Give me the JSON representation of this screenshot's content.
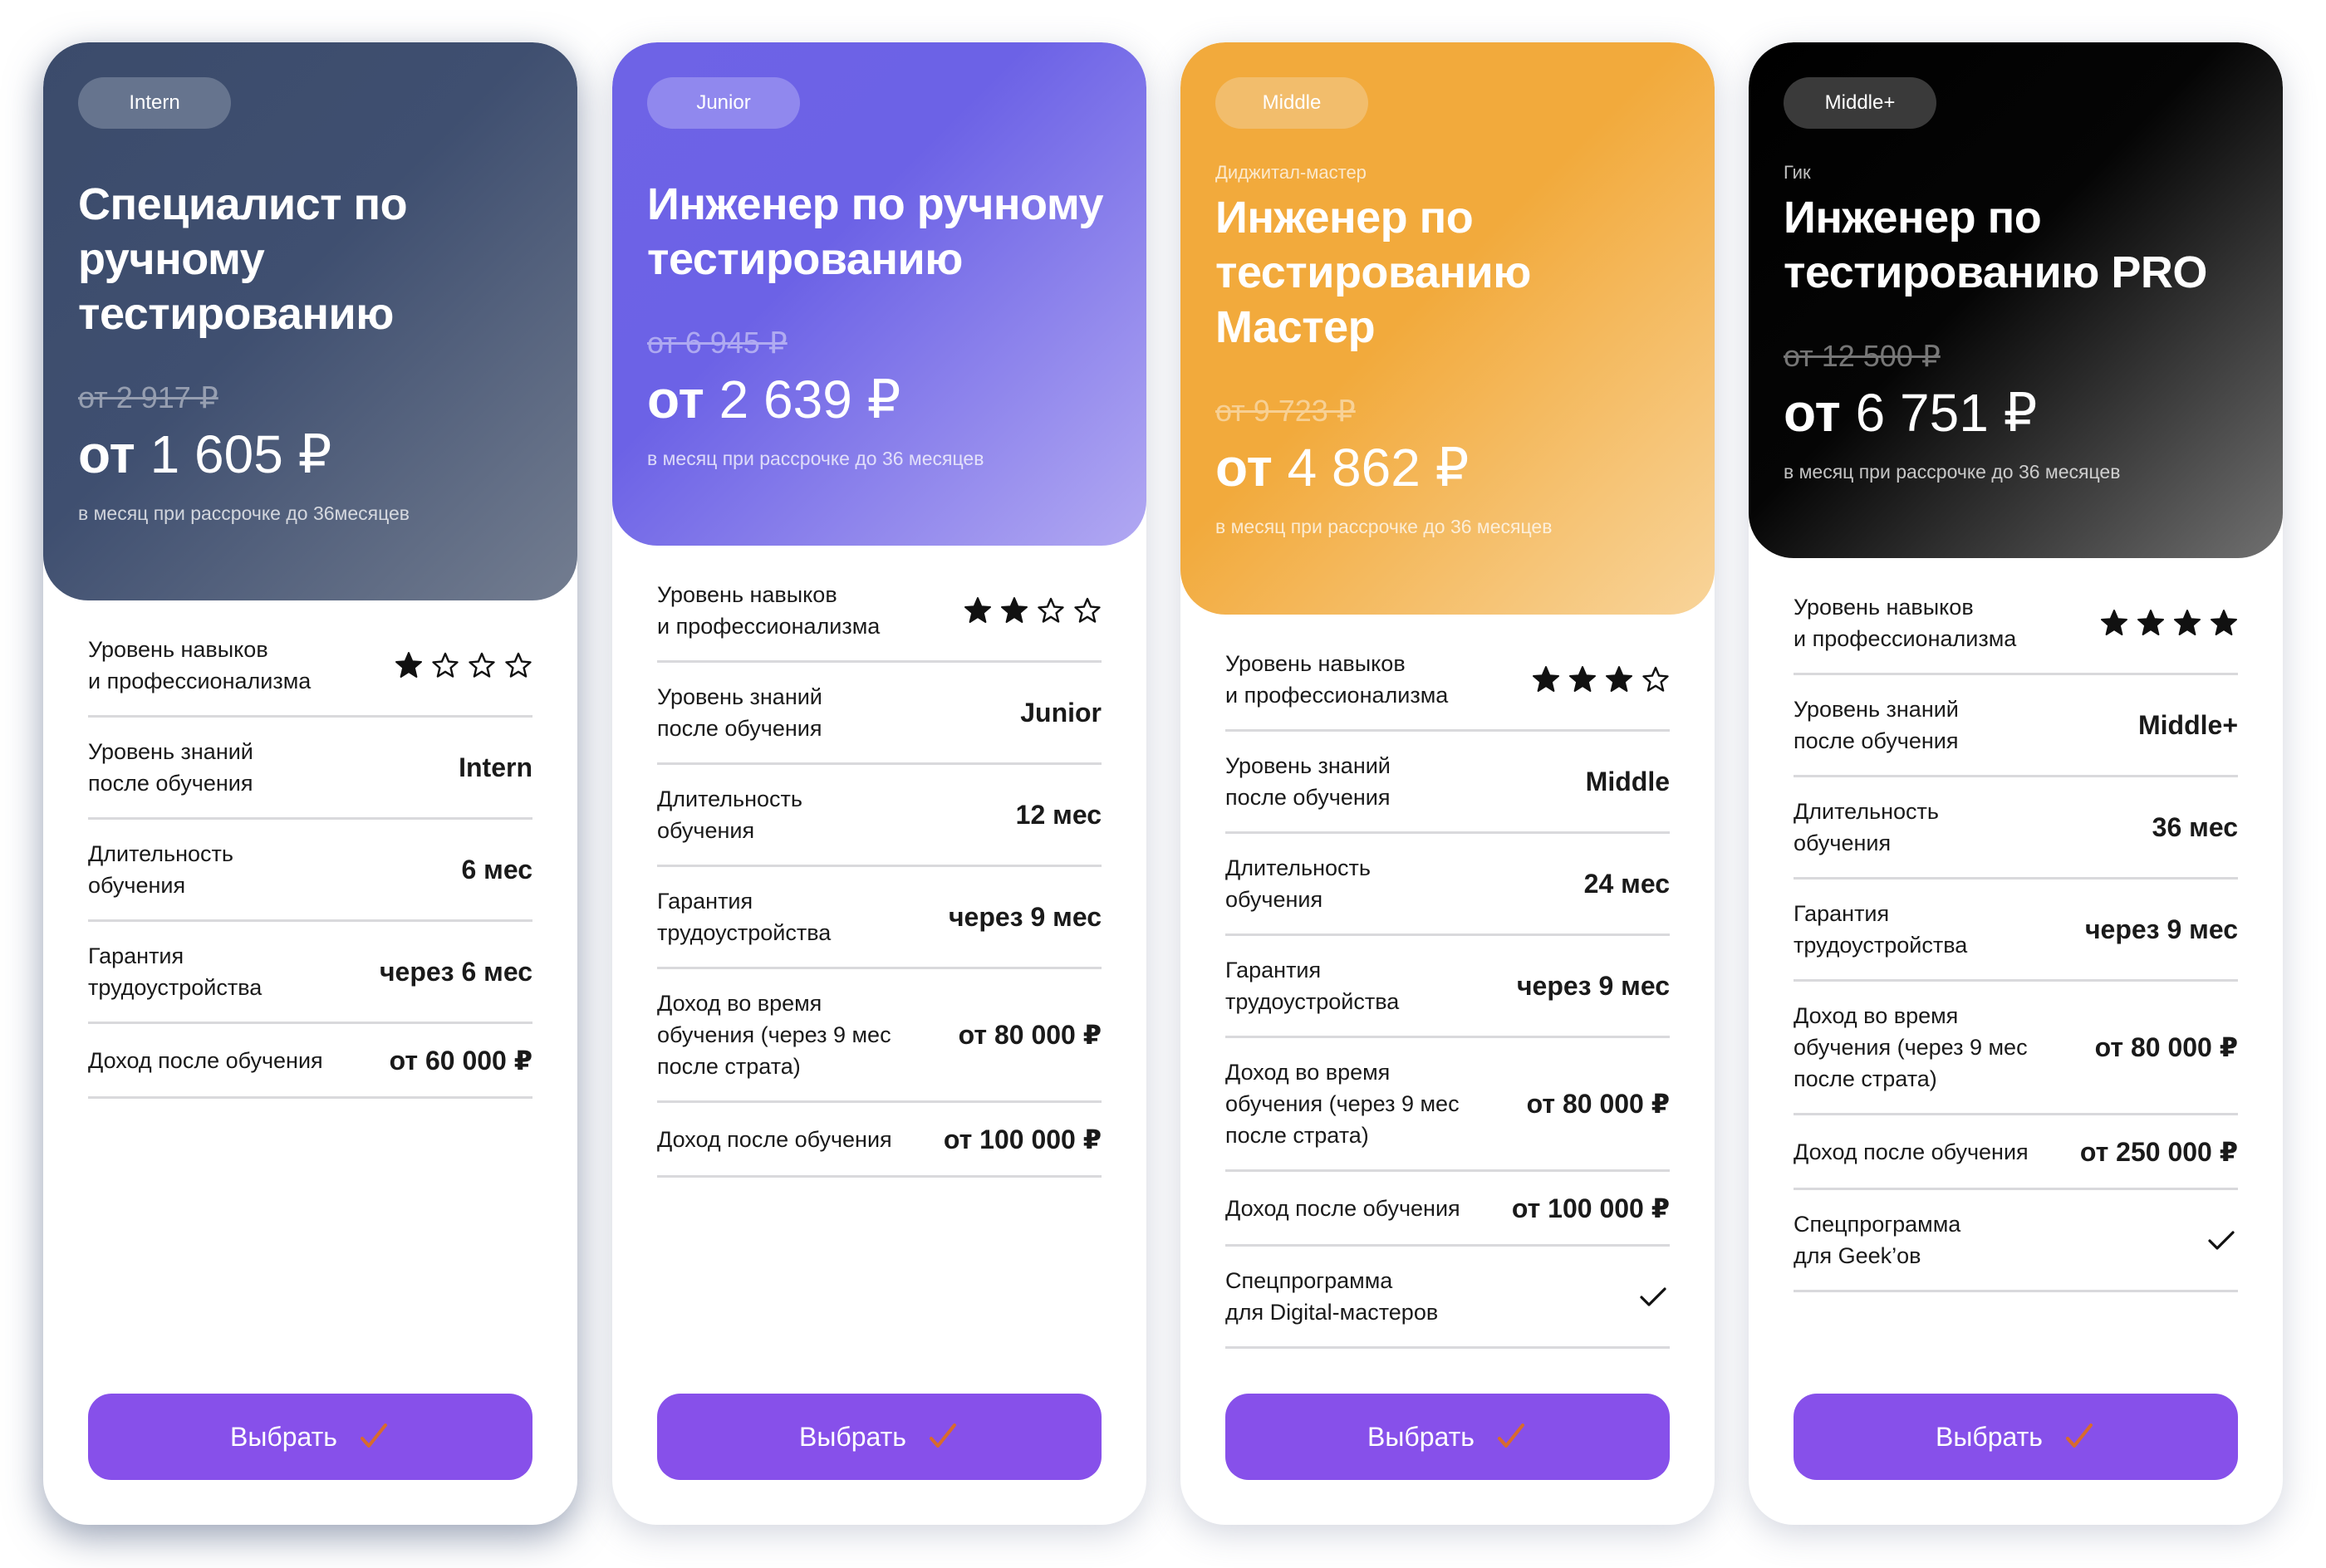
{
  "colors": {
    "button": "#8750ea",
    "button_check": "#d86b2c",
    "intern_header": "#3b4b6b",
    "junior_header": "#6e63e6",
    "middle_header": "#f2aa3c",
    "middleplus_header": "#000000"
  },
  "cards": [
    {
      "badge": "Intern",
      "subtitle": "",
      "title": "Специалист по ручному тестированию",
      "old_price": "от 2 917 ₽",
      "price_from": "от",
      "price_amount": "1 605 ₽",
      "installment": "в месяц при рассрочке до 36месяцев",
      "rows": [
        {
          "label": "Уровень навыков\nи профессионализма",
          "stars": {
            "filled": 1,
            "total": 4
          }
        },
        {
          "label": "Уровень знаний\nпосле обучения",
          "value": "Intern"
        },
        {
          "label": "Длительность\nобучения",
          "value": "6 мес"
        },
        {
          "label": "Гарантия\nтрудоустройства",
          "value": "через 6 мес"
        },
        {
          "label": "Доход после обучения",
          "value": "от 60 000 ₽"
        }
      ],
      "button_label": "Выбрать"
    },
    {
      "badge": "Junior",
      "subtitle": "",
      "title": "Инженер по ручному тестированию",
      "old_price": "от 6 945 ₽",
      "price_from": "от",
      "price_amount": "2 639 ₽",
      "installment": "в месяц при рассрочке до 36 месяцев",
      "rows": [
        {
          "label": "Уровень навыков\nи профессионализма",
          "stars": {
            "filled": 2,
            "total": 4
          }
        },
        {
          "label": "Уровень знаний\nпосле обучения",
          "value": "Junior"
        },
        {
          "label": "Длительность\nобучения",
          "value": "12 мес"
        },
        {
          "label": "Гарантия\nтрудоустройства",
          "value": "через 9 мес"
        },
        {
          "label": "Доход во время\nобучения (через 9 мес\nпосле страта)",
          "value": "от 80 000 ₽"
        },
        {
          "label": "Доход после обучения",
          "value": "от 100 000 ₽"
        }
      ],
      "button_label": "Выбрать"
    },
    {
      "badge": "Middle",
      "subtitle": "Диджитал-мастер",
      "title": "Инженер по тестированию Мастер",
      "old_price": "от 9 723 ₽",
      "price_from": "от",
      "price_amount": "4 862 ₽",
      "installment": "в месяц при рассрочке до 36 месяцев",
      "rows": [
        {
          "label": "Уровень навыков\nи профессионализма",
          "stars": {
            "filled": 3,
            "total": 4
          }
        },
        {
          "label": "Уровень знаний\nпосле обучения",
          "value": "Middle"
        },
        {
          "label": "Длительность\nобучения",
          "value": "24 мес"
        },
        {
          "label": "Гарантия\nтрудоустройства",
          "value": "через 9 мес"
        },
        {
          "label": "Доход во время\nобучения (через 9 мес\nпосле страта)",
          "value": "от 80 000 ₽"
        },
        {
          "label": "Доход после обучения",
          "value": "от 100 000 ₽"
        },
        {
          "label": "Спецпрограмма\nдля Digital-мастеров",
          "check": true
        }
      ],
      "button_label": "Выбрать"
    },
    {
      "badge": "Middle+",
      "subtitle": "Гик",
      "title": "Инженер по тестированию PRO",
      "old_price": "от 12 500 ₽",
      "price_from": "от",
      "price_amount": "6 751 ₽",
      "installment": "в месяц при рассрочке до 36 месяцев",
      "rows": [
        {
          "label": "Уровень навыков\nи профессионализма",
          "stars": {
            "filled": 4,
            "total": 4
          }
        },
        {
          "label": "Уровень знаний\nпосле обучения",
          "value": "Middle+"
        },
        {
          "label": "Длительность\nобучения",
          "value": "36 мес"
        },
        {
          "label": "Гарантия\nтрудоустройства",
          "value": "через 9 мес"
        },
        {
          "label": "Доход во время\nобучения (через 9 мес\nпосле страта)",
          "value": "от 80 000 ₽"
        },
        {
          "label": "Доход после обучения",
          "value": "от 250 000 ₽"
        },
        {
          "label": "Спецпрограмма\nдля Geek’ов",
          "check": true
        }
      ],
      "button_label": "Выбрать"
    }
  ]
}
